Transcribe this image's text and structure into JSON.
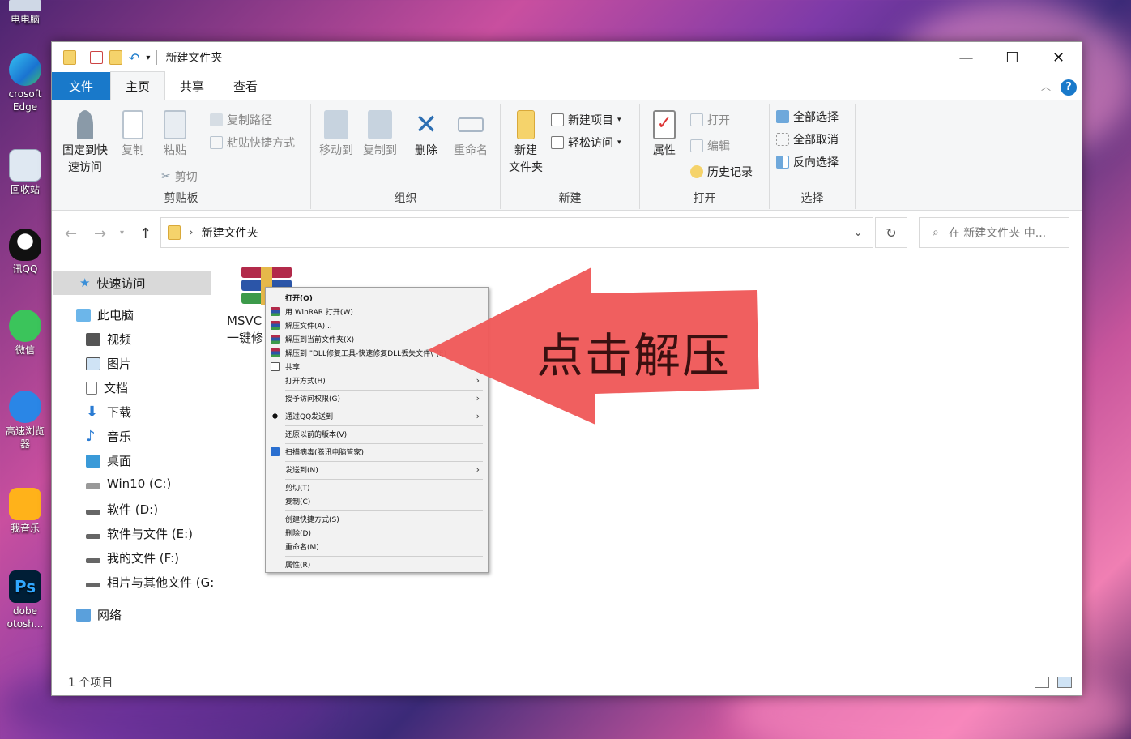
{
  "desktop": {
    "icons": [
      {
        "label": "电电脑"
      },
      {
        "label": "crosoft Edge"
      },
      {
        "label": "回收站"
      },
      {
        "label": "讯QQ"
      },
      {
        "label": "微信"
      },
      {
        "label": "高速浏览器"
      },
      {
        "label": "我音乐"
      },
      {
        "label": "dobe otosh..."
      }
    ]
  },
  "window": {
    "title": "新建文件夹",
    "controls": {
      "minimize": "—",
      "maximize": "☐",
      "close": "✕"
    },
    "help": "?"
  },
  "ribbon_tabs": [
    "文件",
    "主页",
    "共享",
    "查看"
  ],
  "ribbon": {
    "clipboard": {
      "pin": "固定到快\n速访问",
      "copy": "复制",
      "paste": "粘贴",
      "copy_path": "复制路径",
      "paste_shortcut": "粘贴快捷方式",
      "cut": "剪切",
      "label": "剪贴板"
    },
    "organize": {
      "move_to": "移动到",
      "copy_to": "复制到",
      "delete": "删除",
      "rename": "重命名",
      "label": "组织"
    },
    "new": {
      "new_folder": "新建\n文件夹",
      "new_item": "新建项目",
      "easy_access": "轻松访问",
      "label": "新建"
    },
    "open": {
      "properties": "属性",
      "open": "打开",
      "edit": "编辑",
      "history": "历史记录",
      "label": "打开"
    },
    "select": {
      "select_all": "全部选择",
      "select_none": "全部取消",
      "invert": "反向选择",
      "label": "选择"
    }
  },
  "address": {
    "path": "新建文件夹",
    "search_placeholder": "在 新建文件夹 中..."
  },
  "nav": {
    "quick_access": "快速访问",
    "this_pc": "此电脑",
    "items": [
      "视频",
      "图片",
      "文档",
      "下载",
      "音乐",
      "桌面",
      "Win10 (C:)",
      "软件 (D:)",
      "软件与文件 (E:)",
      "我的文件 (F:)",
      "相片与其他文件 (G:"
    ],
    "network": "网络"
  },
  "file": {
    "name_line1": "MSVC",
    "name_line2": "一键修"
  },
  "status": {
    "count": "1 个项目"
  },
  "context_menu": {
    "items": [
      {
        "label": "打开(O)",
        "bold": true,
        "icon": "none"
      },
      {
        "label": "用 WinRAR 打开(W)",
        "icon": "winrar-icon"
      },
      {
        "label": "解压文件(A)...",
        "icon": "winrar-icon"
      },
      {
        "label": "解压到当前文件夹(X)",
        "icon": "winrar-icon"
      },
      {
        "label": "解压到 \"DLL修复工具-快速修复DLL丢失文件\\\"(E)",
        "icon": "winrar-icon"
      },
      {
        "label": "共享",
        "icon": "share-icon"
      },
      {
        "label": "打开方式(H)",
        "icon": "none",
        "submenu": true
      },
      {
        "label": "授予访问权限(G)",
        "icon": "none",
        "submenu": true
      },
      {
        "label": "通过QQ发送到",
        "icon": "qq-icon",
        "submenu": true
      },
      {
        "label": "还原以前的版本(V)",
        "icon": "none"
      },
      {
        "label": "扫描病毒(腾讯电脑管家)",
        "icon": "shield-icon"
      },
      {
        "label": "发送到(N)",
        "icon": "none",
        "submenu": true
      },
      {
        "label": "剪切(T)",
        "icon": "none"
      },
      {
        "label": "复制(C)",
        "icon": "none"
      },
      {
        "label": "创建快捷方式(S)",
        "icon": "none"
      },
      {
        "label": "删除(D)",
        "icon": "none"
      },
      {
        "label": "重命名(M)",
        "icon": "none"
      },
      {
        "label": "属性(R)",
        "icon": "none"
      }
    ]
  },
  "annotation": {
    "text": "点击解压",
    "color": "#f05a5a"
  },
  "colors": {
    "accent": "#1979ca",
    "folder": "#f5d36b"
  }
}
